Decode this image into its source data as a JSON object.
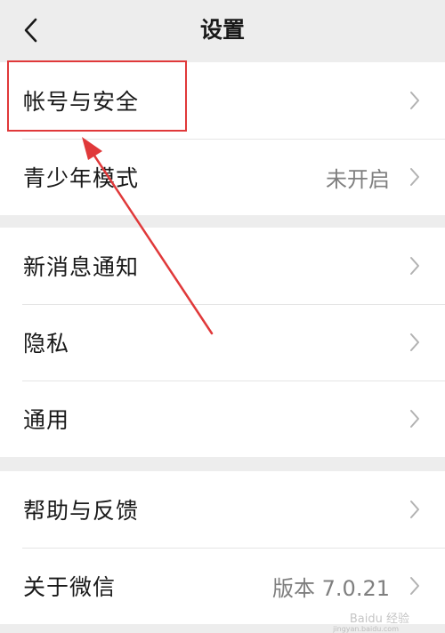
{
  "header": {
    "title": "设置",
    "back_icon": "chevron-left-icon"
  },
  "groups": [
    {
      "items": [
        {
          "label": "帐号与安全",
          "value": ""
        },
        {
          "label": "青少年模式",
          "value": "未开启"
        }
      ]
    },
    {
      "items": [
        {
          "label": "新消息通知",
          "value": ""
        },
        {
          "label": "隐私",
          "value": ""
        },
        {
          "label": "通用",
          "value": ""
        }
      ]
    },
    {
      "items": [
        {
          "label": "帮助与反馈",
          "value": ""
        },
        {
          "label": "关于微信",
          "value": "版本 7.0.21"
        }
      ]
    }
  ],
  "annotation": {
    "color": "#e0393a",
    "highlighted_item": "帐号与安全"
  },
  "watermark": {
    "text": "Baidu 经验",
    "subtext": "jingyan.baidu.com"
  },
  "colors": {
    "background": "#ededed",
    "card": "#ffffff",
    "text": "#191919",
    "secondary_text": "#7f7f7f",
    "chevron": "#b2b2b2"
  }
}
